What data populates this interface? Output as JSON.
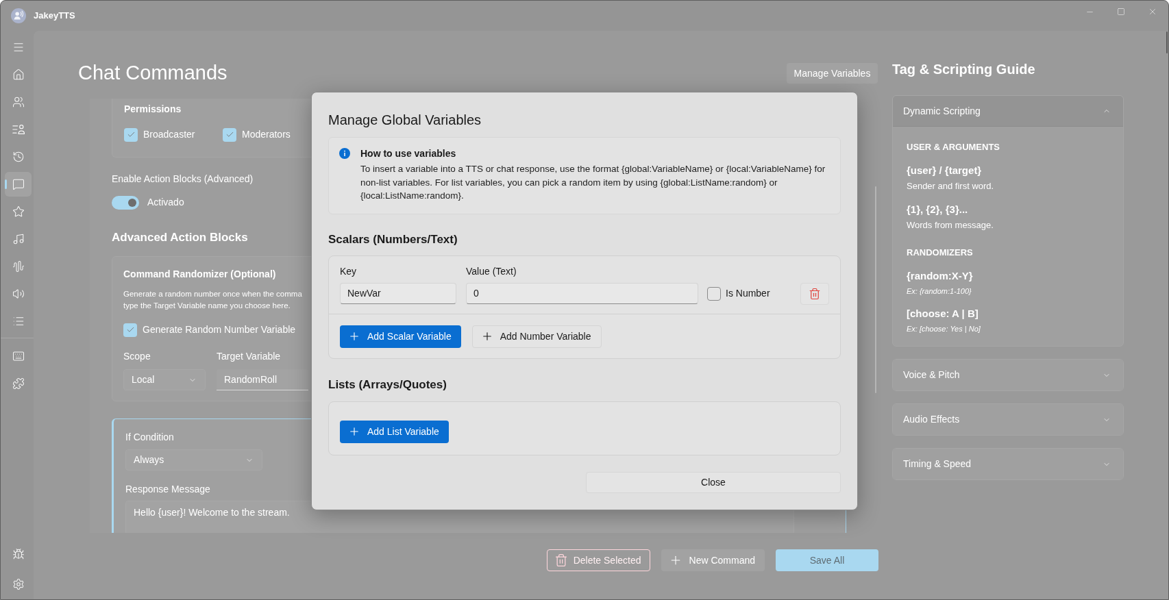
{
  "window": {
    "title": "JakeyTTS"
  },
  "sidebar": {
    "nav_items": [
      {
        "selected": false
      },
      {
        "selected": false
      },
      {
        "selected": false
      },
      {
        "selected": false
      },
      {
        "selected": true
      },
      {
        "selected": false
      },
      {
        "selected": false
      },
      {
        "selected": false
      },
      {
        "selected": false
      },
      {
        "selected": false
      }
    ],
    "tool_items": [
      {
        "selected": false
      },
      {
        "selected": false
      }
    ],
    "footer_items": [
      {
        "selected": false
      },
      {
        "selected": false
      }
    ]
  },
  "page": {
    "title": "Chat Commands",
    "manage_variables_button": "Manage Variables"
  },
  "editor": {
    "permissions": {
      "title": "Permissions",
      "options": [
        {
          "label": "Broadcaster",
          "checked": true
        },
        {
          "label": "Moderators",
          "checked": true
        }
      ]
    },
    "action_blocks_toggle": {
      "label": "Enable Action Blocks (Advanced)",
      "on": true,
      "state_text": "Activado"
    },
    "advanced_heading": "Advanced Action Blocks",
    "randomizer": {
      "title": "Command Randomizer (Optional)",
      "description_lines": [
        "Generate a random number once when the comma",
        "type the Target Variable name you choose here."
      ],
      "generate_option": {
        "label": "Generate Random Number Variable",
        "checked": true
      },
      "scope": {
        "label": "Scope",
        "value": "Local"
      },
      "target_variable": {
        "label": "Target Variable",
        "value": "RandomRoll"
      }
    },
    "action_block": {
      "selected": true,
      "condition": {
        "label": "If Condition",
        "value": "Always"
      },
      "response": {
        "label": "Response Message",
        "value": "Hello {user}! Welcome to the stream."
      }
    }
  },
  "command_bar": {
    "buttons": [
      {
        "label": "Delete Selected",
        "kind": "danger"
      },
      {
        "label": "New Command",
        "kind": "secondary"
      },
      {
        "label": "Save All",
        "kind": "primary"
      }
    ]
  },
  "guide": {
    "title": "Tag & Scripting Guide",
    "sections": [
      {
        "title": "Dynamic Scripting",
        "expanded": true,
        "groups": [
          {
            "heading": "USER & ARGUMENTS",
            "entries": [
              {
                "tag": "{user} / {target}",
                "description": "Sender and first word."
              },
              {
                "tag": "{1}, {2}, {3}...",
                "description": "Words from message."
              }
            ]
          },
          {
            "heading": "RANDOMIZERS",
            "entries": [
              {
                "tag": "{random:X-Y}",
                "example": "Ex: {random:1-100}"
              },
              {
                "tag": "[choose: A | B]",
                "example": "Ex: [choose: Yes | No]"
              }
            ]
          }
        ]
      },
      {
        "title": "Voice & Pitch",
        "expanded": false
      },
      {
        "title": "Audio Effects",
        "expanded": false
      },
      {
        "title": "Timing & Speed",
        "expanded": false
      }
    ]
  },
  "dialog": {
    "title": "Manage Global Variables",
    "info": {
      "title": "How to use variables",
      "body": "To insert a variable into a TTS or chat response, use the format {global:VariableName} or {local:VariableName} for non-list variables. For list variables, you can pick a random item by using {global:ListName:random} or {local:ListName:random}."
    },
    "scalars": {
      "heading": "Scalars (Numbers/Text)",
      "columns": [
        "Key",
        "Value (Text)"
      ],
      "rows": [
        {
          "key": "NewVar",
          "value": "0",
          "number_option": {
            "label": "Is Number",
            "checked": false
          }
        }
      ],
      "buttons": [
        {
          "label": "Add Scalar Variable",
          "kind": "primary"
        },
        {
          "label": "Add Number Variable",
          "kind": "secondary"
        }
      ]
    },
    "lists": {
      "heading": "Lists (Arrays/Quotes)",
      "buttons": [
        {
          "label": "Add List Variable",
          "kind": "primary"
        }
      ]
    },
    "close_button": "Close"
  }
}
